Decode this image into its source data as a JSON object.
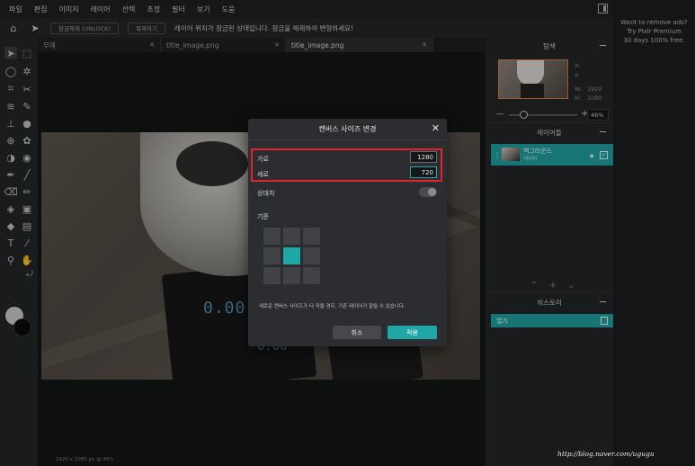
{
  "menubar": {
    "items": [
      "파일",
      "편집",
      "이미지",
      "레이어",
      "선택",
      "조정",
      "필터",
      "보기",
      "도움"
    ]
  },
  "ad": {
    "line1": "Want to remove ads?",
    "line2": "Try Pixlr Premium",
    "line3": "30 days 100% free."
  },
  "toolbar": {
    "unlock_label": "잠금해제 (UNLOCK)",
    "duplicate_label": "복제하기",
    "message": "레이어 위치가 잠금된 상태입니다. 잠금을 해제하여 변형하세요!"
  },
  "tabs": [
    {
      "label": "무제",
      "active": false
    },
    {
      "label": "title_image.png",
      "active": false
    },
    {
      "label": "title_image.png",
      "active": true
    }
  ],
  "canvas": {
    "status": "1920 x 1080 px @ 46%",
    "watermark": "http://blog.naver.com/ugugu"
  },
  "navigator": {
    "title": "탐색",
    "x_label": "X:",
    "y_label": "Y:",
    "w_label": "W:",
    "w_value": "1920",
    "h_label": "H:",
    "h_value": "1080",
    "zoom": "46%"
  },
  "layers": {
    "title": "레이어들",
    "items": [
      {
        "name": "백그라운드",
        "sub": "레이어"
      }
    ]
  },
  "history": {
    "title": "히스토리",
    "items": [
      "열기"
    ]
  },
  "dialog": {
    "title": "캔버스 사이즈 변경",
    "width_label": "가로",
    "width_value": "1280",
    "height_label": "세로",
    "height_value": "720",
    "relative_label": "상대치",
    "relative_on": false,
    "anchor_label": "기준",
    "anchor_selected": "center",
    "note": "새로운 캔버스 사이즈가 더 작을 경우, 기존 레이어가 잘릴 수 있습니다.",
    "cancel_label": "취소",
    "apply_label": "적용"
  },
  "colors": {
    "accent": "#1fa6a6",
    "highlight_box": "#e0232c",
    "foreground": "#c8c8c8",
    "background": "#0b0b0b"
  },
  "icons": {
    "tools": [
      "arrange-icon",
      "marquee-icon",
      "lasso-icon",
      "quick-select-icon",
      "crop-icon",
      "cutout-icon",
      "liquify-icon",
      "heal-icon",
      "clone-icon",
      "blur-icon",
      "sponge-icon",
      "color-replace-icon",
      "dodge-icon",
      "burn-icon",
      "pen-icon",
      "brush-icon",
      "eraser-icon",
      "pencil-icon",
      "fill-icon",
      "gradient-icon",
      "shape-icon",
      "image-icon",
      "text-icon",
      "eyedropper-icon",
      "zoom-icon",
      "hand-icon"
    ]
  }
}
